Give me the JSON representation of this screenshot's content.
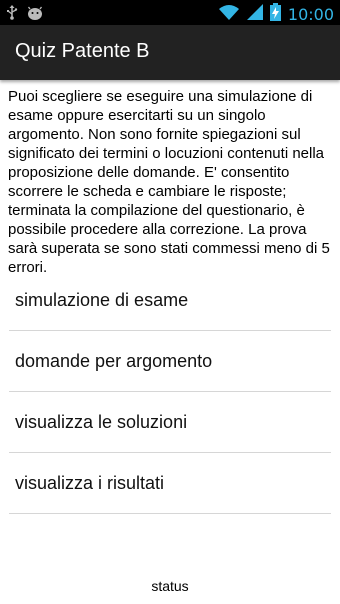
{
  "statusbar": {
    "time": "10:00",
    "icons": [
      "usb-icon",
      "android-debug-icon",
      "wifi-icon",
      "signal-icon",
      "battery-charging-icon"
    ],
    "accent_color": "#33b5e5"
  },
  "actionbar": {
    "title": "Quiz Patente B"
  },
  "description": "Puoi scegliere se eseguire una simulazione di esame oppure esercitarti su un singolo argomento. Non sono fornite spiegazioni sul significato dei termini o locuzioni contenuti nella proposizione delle domande. E' consentito scorrere le scheda e cambiare le risposte; terminata la compilazione del questionario, è possibile procedere alla correzione. La prova sarà superata se sono stati commessi meno di 5 errori.",
  "menu": [
    {
      "label": "simulazione di esame"
    },
    {
      "label": "domande per argomento"
    },
    {
      "label": "visualizza le soluzioni"
    },
    {
      "label": "visualizza i risultati"
    }
  ],
  "footer": {
    "status": "status"
  }
}
